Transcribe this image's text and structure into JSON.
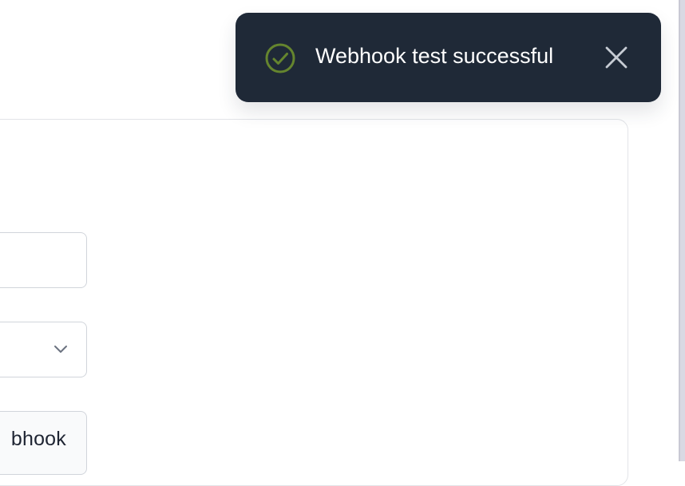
{
  "toast": {
    "message": "Webhook test successful",
    "status_color": "#65852e",
    "background": "#1f2937",
    "icons": {
      "status": "check-circle-icon",
      "close": "close-icon"
    }
  },
  "form": {
    "select_icon": "chevron-down-icon",
    "action_label": "bhook"
  }
}
